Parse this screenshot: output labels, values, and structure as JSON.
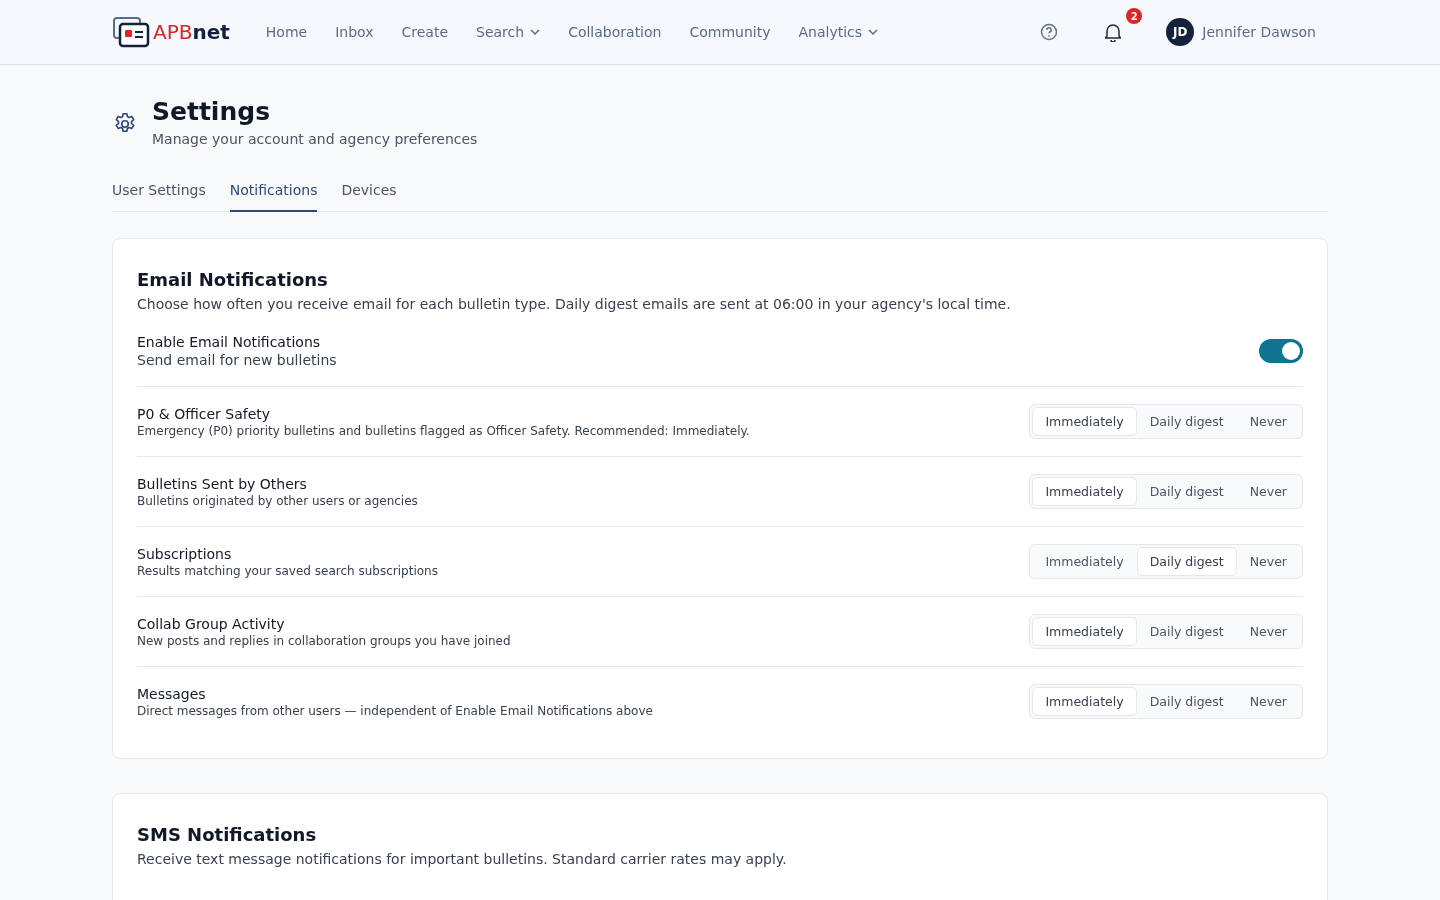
{
  "nav": {
    "logo_primary": "APB",
    "logo_secondary": "net",
    "links": [
      {
        "label": "Home",
        "dropdown": false
      },
      {
        "label": "Inbox",
        "dropdown": false
      },
      {
        "label": "Create",
        "dropdown": false
      },
      {
        "label": "Search",
        "dropdown": true
      },
      {
        "label": "Collaboration",
        "dropdown": false
      },
      {
        "label": "Community",
        "dropdown": false
      },
      {
        "label": "Analytics",
        "dropdown": true
      }
    ],
    "notification_count": "2",
    "user": {
      "initials": "JD",
      "name": "Jennifer Dawson"
    }
  },
  "page": {
    "title": "Settings",
    "subtitle": "Manage your account and agency preferences"
  },
  "tabs": [
    {
      "label": "User Settings",
      "selected": false
    },
    {
      "label": "Notifications",
      "selected": true
    },
    {
      "label": "Devices",
      "selected": false
    }
  ],
  "email": {
    "title": "Email Notifications",
    "description": "Choose how often you receive email for each bulletin type. Daily digest emails are sent at 06:00 in your agency's local time.",
    "master": {
      "label": "Enable Email Notifications",
      "hint": "Send email for new bulletins",
      "on": true,
      "disabled": false
    },
    "rows": [
      {
        "label": "P0 & Officer Safety",
        "hint": "Emergency (P0) priority bulletins and bulletins flagged as Officer Safety. Recommended: Immediately.",
        "options": [
          {
            "label": "Immediately",
            "selected": true
          },
          {
            "label": "Daily digest",
            "selected": false
          },
          {
            "label": "Never",
            "selected": false
          }
        ]
      },
      {
        "label": "Bulletins Sent by Others",
        "hint": "Bulletins originated by other users or agencies",
        "options": [
          {
            "label": "Immediately",
            "selected": true
          },
          {
            "label": "Daily digest",
            "selected": false
          },
          {
            "label": "Never",
            "selected": false
          }
        ]
      },
      {
        "label": "Subscriptions",
        "hint": "Results matching your saved search subscriptions",
        "options": [
          {
            "label": "Immediately",
            "selected": false
          },
          {
            "label": "Daily digest",
            "selected": true
          },
          {
            "label": "Never",
            "selected": false
          }
        ]
      },
      {
        "label": "Collab Group Activity",
        "hint": "New posts and replies in collaboration groups you have joined",
        "options": [
          {
            "label": "Immediately",
            "selected": true
          },
          {
            "label": "Daily digest",
            "selected": false
          },
          {
            "label": "Never",
            "selected": false
          }
        ]
      },
      {
        "label": "Messages",
        "hint": "Direct messages from other users — independent of Enable Email Notifications above",
        "options": [
          {
            "label": "Immediately",
            "selected": true
          },
          {
            "label": "Daily digest",
            "selected": false
          },
          {
            "label": "Never",
            "selected": false
          }
        ]
      }
    ]
  },
  "sms": {
    "title": "SMS Notifications",
    "description": "Receive text message notifications for important bulletins. Standard carrier rates may apply."
  }
}
